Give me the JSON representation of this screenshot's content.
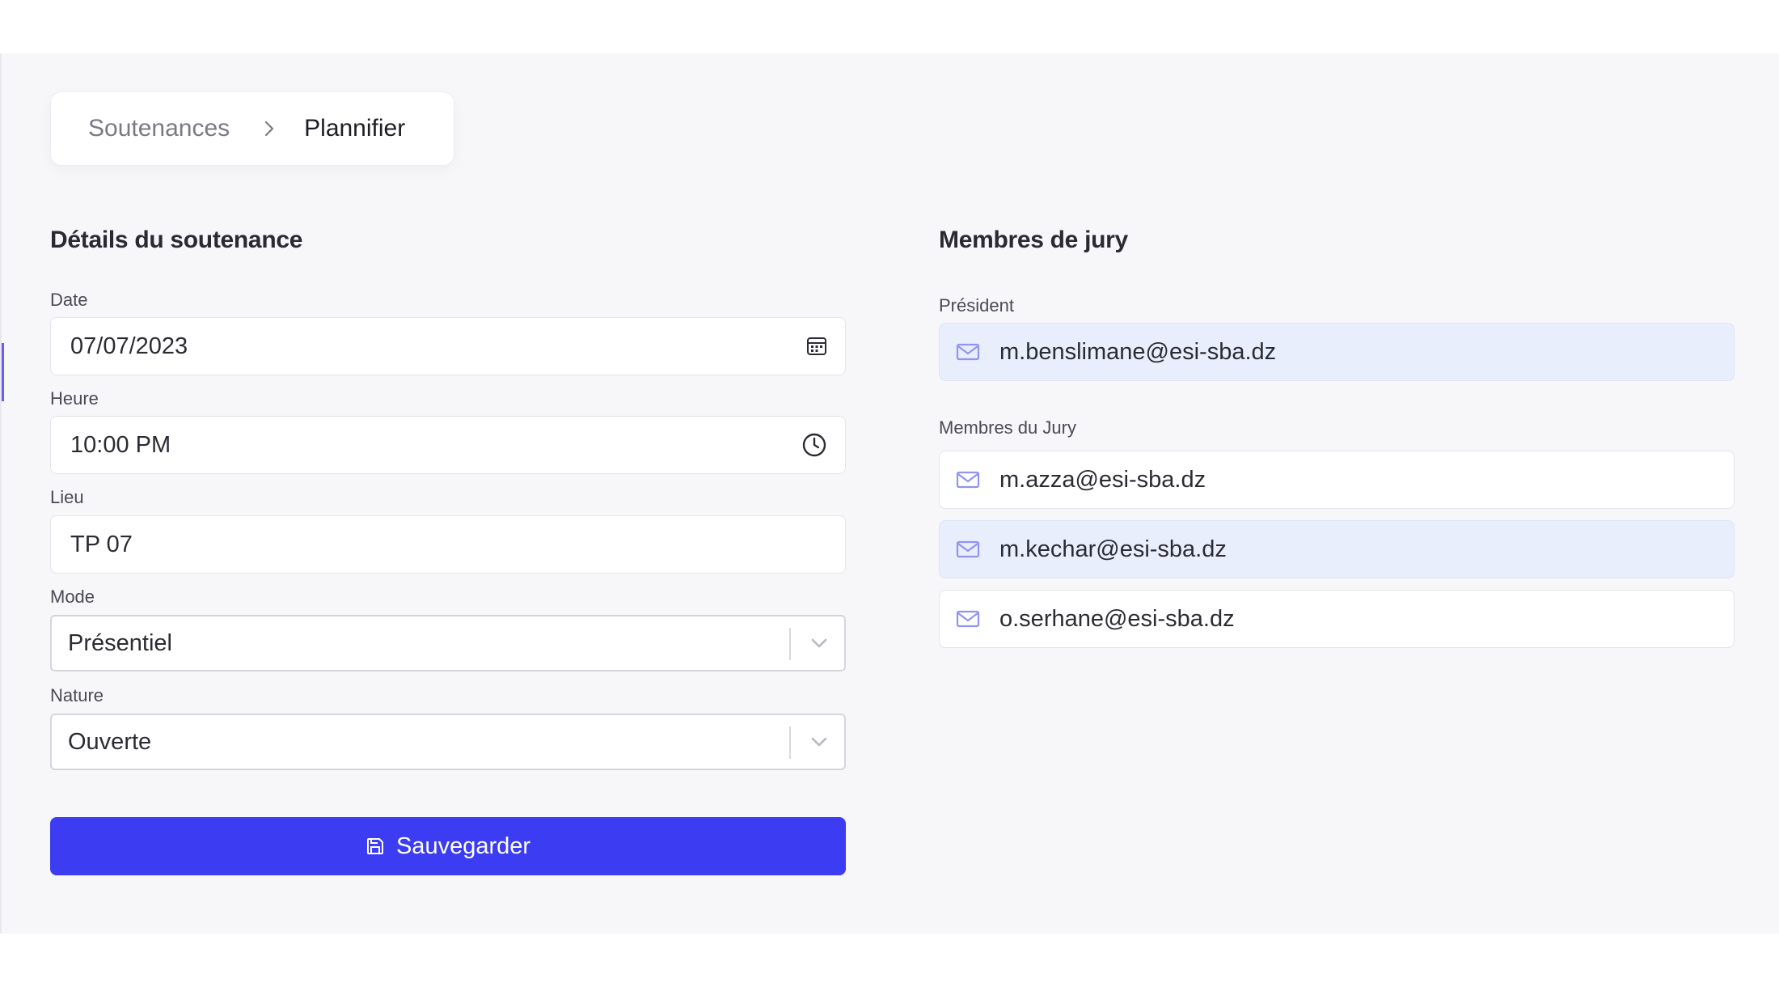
{
  "breadcrumb": {
    "parent": "Soutenances",
    "current": "Plannifier"
  },
  "details": {
    "title": "Détails du soutenance",
    "date": {
      "label": "Date",
      "value": "07/07/2023"
    },
    "heure": {
      "label": "Heure",
      "value": "10:00 PM"
    },
    "lieu": {
      "label": "Lieu",
      "value": "TP 07"
    },
    "mode": {
      "label": "Mode",
      "value": "Présentiel"
    },
    "nature": {
      "label": "Nature",
      "value": "Ouverte"
    },
    "save_label": "Sauvegarder"
  },
  "jury": {
    "title": "Membres de jury",
    "president_label": "Président",
    "president_email": "m.benslimane@esi-sba.dz",
    "members_label": "Membres du Jury",
    "members": [
      "m.azza@esi-sba.dz",
      "m.kechar@esi-sba.dz",
      "o.serhane@esi-sba.dz"
    ]
  },
  "colors": {
    "accent": "#3c3cf2",
    "highlight": "#e9eefc",
    "mail_icon": "#8f95f0"
  }
}
